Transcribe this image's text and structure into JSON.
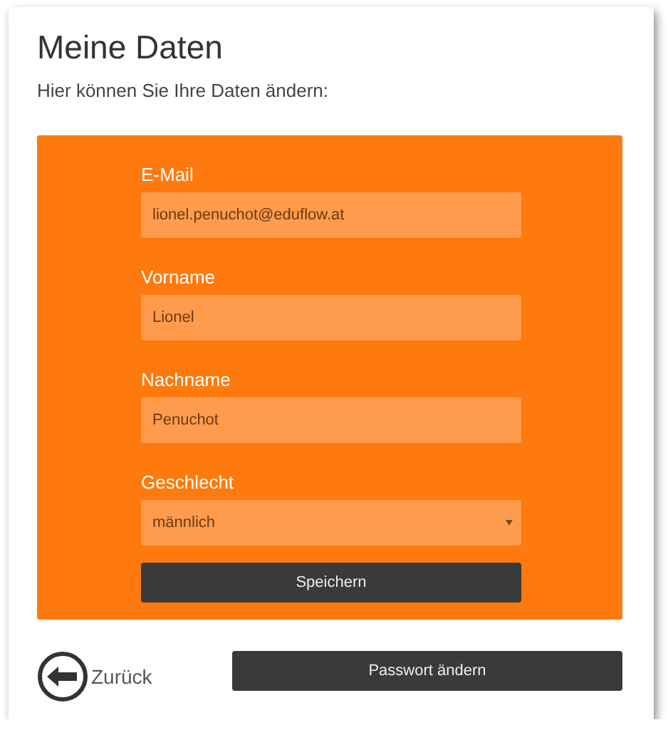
{
  "title": "Meine Daten",
  "subtitle": "Hier können Sie Ihre Daten ändern:",
  "fields": [
    {
      "kind": "text",
      "label": "E-Mail",
      "value": "lionel.penuchot@eduflow.at"
    },
    {
      "kind": "text",
      "label": "Vorname",
      "value": "Lionel"
    },
    {
      "kind": "text",
      "label": "Nachname",
      "value": "Penuchot"
    },
    {
      "kind": "select",
      "label": "Geschlecht",
      "value": "männlich"
    }
  ],
  "save_button": "Speichern",
  "back_link": "Zurück",
  "password_button": "Passwort ändern"
}
